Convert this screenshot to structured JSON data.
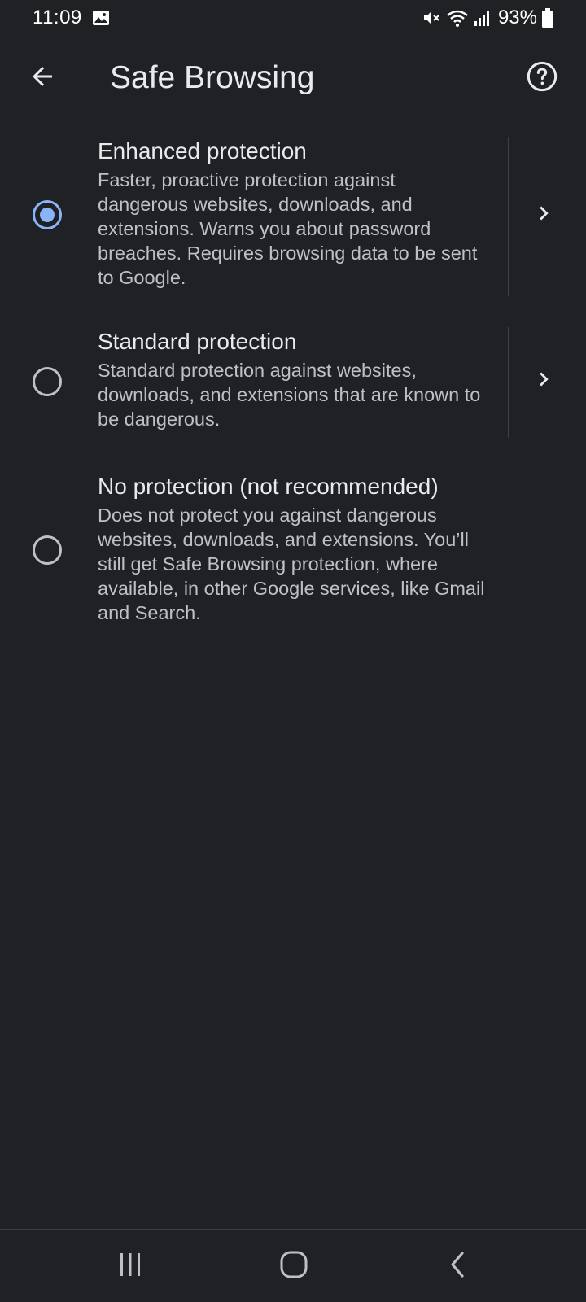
{
  "status_bar": {
    "time": "11:09",
    "battery_percent": "93%",
    "icons": [
      "gallery-icon",
      "mute-icon",
      "wifi-icon",
      "signal-icon",
      "battery-icon"
    ]
  },
  "app_bar": {
    "title": "Safe Browsing",
    "back_icon": "arrow-back-icon",
    "help_icon": "help-circle-icon"
  },
  "options": [
    {
      "title": "Enhanced protection",
      "description": "Faster, proactive protection against dangerous websites, downloads, and extensions. Warns you about password breaches. Requires browsing data to be sent to Google.",
      "selected": true,
      "has_details": true
    },
    {
      "title": "Standard protection",
      "description": "Standard protection against websites, downloads, and extensions that are known to be dangerous.",
      "selected": false,
      "has_details": true
    },
    {
      "title": "No protection (not recommended)",
      "description": "Does not protect you against dangerous websites, downloads, and extensions. You’ll still get Safe Browsing protection, where available, in other Google services, like Gmail and Search.",
      "selected": false,
      "has_details": false
    }
  ],
  "nav_bar": {
    "icons": [
      "recents-icon",
      "home-icon",
      "back-icon"
    ]
  },
  "colors": {
    "background": "#202124",
    "accent": "#8ab4f8",
    "text_primary": "#e8eaed",
    "text_secondary": "#bdc1c6"
  }
}
